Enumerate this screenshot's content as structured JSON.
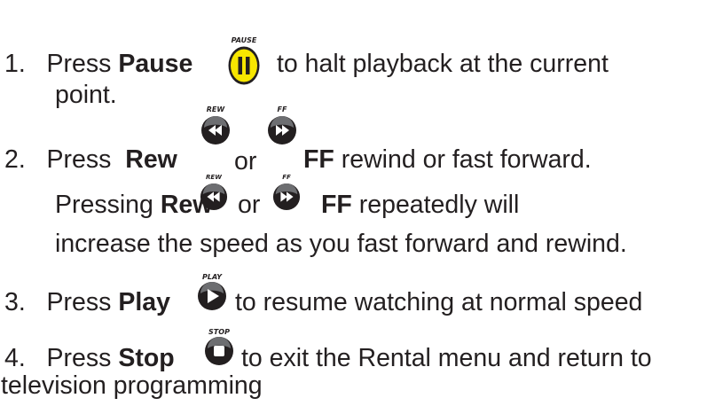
{
  "steps": [
    {
      "number": "1.",
      "verb": "Press",
      "keyword": "Pause",
      "text_after": "to halt playback at the current",
      "text_cont": "point.",
      "icon_caption": "PAUSE"
    },
    {
      "number": "2.",
      "verb": "Press",
      "keyword_a": "Rew",
      "or": "or",
      "keyword_b": "FF",
      "text_after": "rewind or fast forward.",
      "line2_verb": "Pressing",
      "line2_keyword_a": "Rew",
      "line2_or": "or",
      "line2_keyword_b": "FF",
      "line2_text": "repeatedly will",
      "line3_text": "increase the speed as you fast forward and rewind.",
      "icon_caption_rew": "REW",
      "icon_caption_ff": "FF"
    },
    {
      "number": "3.",
      "verb": "Press",
      "keyword": "Play",
      "text_after": "to resume watching at normal speed",
      "icon_caption": "PLAY"
    },
    {
      "number": "4.",
      "verb": "Press",
      "keyword": "Stop",
      "text_after": "to exit the Rental menu and return to",
      "text_cont": "television programming",
      "icon_caption": "STOP"
    }
  ],
  "colors": {
    "text": "#231f20",
    "pause_button": "#f7e600",
    "dark_button": "#231f20"
  },
  "icons": {
    "pause": "pause-icon",
    "rewind": "rewind-icon",
    "fast_forward": "fast-forward-icon",
    "play": "play-icon",
    "stop": "stop-icon"
  }
}
